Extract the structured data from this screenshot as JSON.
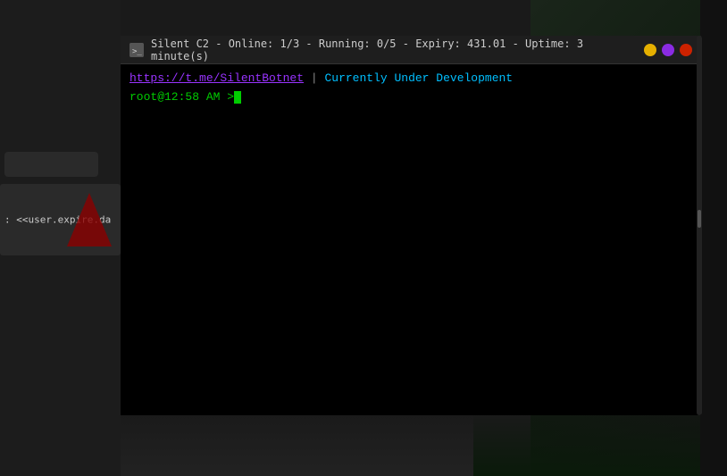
{
  "titlebar": {
    "icon_label": "terminal-icon",
    "app_name": "Silent C2",
    "online_label": "Online:",
    "online_value": "1/3",
    "running_label": "Running:",
    "running_value": "0/5",
    "expiry_label": "Expiry:",
    "expiry_value": "431.01",
    "uptime_label": "Uptime:",
    "uptime_value": "3 minute(s)",
    "separator": "-",
    "full_text": "Silent C2  -  Online: 1/3  -  Running: 0/5  -  Expiry: 431.01  -  Uptime: 3 minute(s)"
  },
  "terminal": {
    "link_text": "https://t.me/SilentBotnet",
    "pipe": "|",
    "banner_text": "Currently Under Development",
    "prompt": "root@12:58 AM >",
    "cursor": "_"
  },
  "sidebar": {
    "input_placeholder": "",
    "item_text": ": <<user.expire.da"
  },
  "dots": {
    "yellow_label": "minimize",
    "purple_label": "maximize",
    "red_label": "close"
  }
}
